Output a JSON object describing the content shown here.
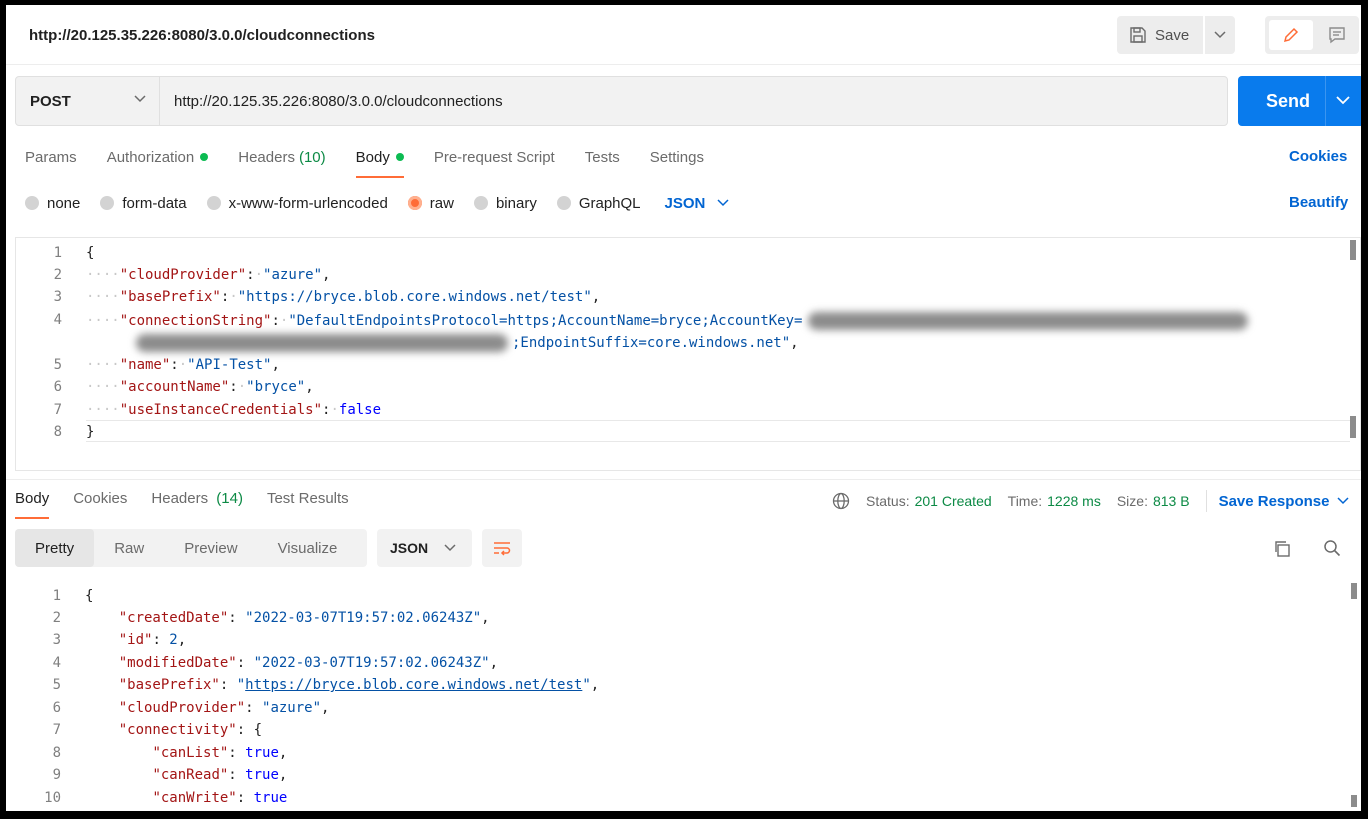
{
  "title": "http://20.125.35.226:8080/3.0.0/cloudconnections",
  "toolbar": {
    "save_label": "Save"
  },
  "request": {
    "method": "POST",
    "url": "http://20.125.35.226:8080/3.0.0/cloudconnections",
    "send_label": "Send"
  },
  "req_tabs": [
    {
      "label": "Params",
      "count": "",
      "dot": false
    },
    {
      "label": "Authorization",
      "count": "",
      "dot": true
    },
    {
      "label": "Headers",
      "count": "(10)",
      "dot": false
    },
    {
      "label": "Body",
      "count": "",
      "dot": true,
      "active": true
    },
    {
      "label": "Pre-request Script",
      "count": "",
      "dot": false
    },
    {
      "label": "Tests",
      "count": "",
      "dot": false
    },
    {
      "label": "Settings",
      "count": "",
      "dot": false
    }
  ],
  "cookies_label": "Cookies",
  "body_types": [
    {
      "label": "none",
      "selected": false
    },
    {
      "label": "form-data",
      "selected": false
    },
    {
      "label": "x-www-form-urlencoded",
      "selected": false
    },
    {
      "label": "raw",
      "selected": true
    },
    {
      "label": "binary",
      "selected": false
    },
    {
      "label": "GraphQL",
      "selected": false
    }
  ],
  "body_format": "JSON",
  "beautify_label": "Beautify",
  "request_body": {
    "line_numbers": [
      "1",
      "2",
      "3",
      "4",
      "5",
      "6",
      "7",
      "8"
    ],
    "open": "{",
    "close": "}",
    "k1": "\"cloudProvider\"",
    "v1": "\"azure\"",
    "k2": "\"basePrefix\"",
    "v2": "\"https://bryce.blob.core.windows.net/test\"",
    "k3": "\"connectionString\"",
    "v3a": "\"DefaultEndpointsProtocol=https;AccountName=bryce;AccountKey=",
    "v3b": ";EndpointSuffix=core.windows.net\"",
    "k4": "\"name\"",
    "v4": "\"API-Test\"",
    "k5": "\"accountName\"",
    "v5": "\"bryce\"",
    "k6": "\"useInstanceCredentials\"",
    "v6": "false"
  },
  "res_tabs": [
    {
      "label": "Body",
      "count": "",
      "active": true
    },
    {
      "label": "Cookies",
      "count": ""
    },
    {
      "label": "Headers",
      "count": "(14)"
    },
    {
      "label": "Test Results",
      "count": ""
    }
  ],
  "status": {
    "status_label": "Status:",
    "status_value": "201 Created",
    "time_label": "Time:",
    "time_value": "1228 ms",
    "size_label": "Size:",
    "size_value": "813 B"
  },
  "save_response_label": "Save Response",
  "view_tabs": [
    "Pretty",
    "Raw",
    "Preview",
    "Visualize"
  ],
  "response_format": "JSON",
  "response_body": {
    "line_numbers": [
      "1",
      "2",
      "3",
      "4",
      "5",
      "6",
      "7",
      "8",
      "9",
      "10"
    ],
    "open": "{",
    "k1": "\"createdDate\"",
    "v1": "\"2022-03-07T19:57:02.06243Z\"",
    "k2": "\"id\"",
    "v2": "2",
    "k3": "\"modifiedDate\"",
    "v3": "\"2022-03-07T19:57:02.06243Z\"",
    "k4": "\"basePrefix\"",
    "v4": "https://bryce.blob.core.windows.net/test",
    "k5": "\"cloudProvider\"",
    "v5": "\"azure\"",
    "k6": "\"connectivity\"",
    "v6": "{",
    "k7": "\"canList\"",
    "v7": "true",
    "k8": "\"canRead\"",
    "v8": "true",
    "k9": "\"canWrite\"",
    "v9": "true"
  },
  "colors": {
    "accent_orange": "#ff6c37",
    "send_blue": "#097bed",
    "link_blue": "#0265d2",
    "status_green": "#0c8a45"
  }
}
